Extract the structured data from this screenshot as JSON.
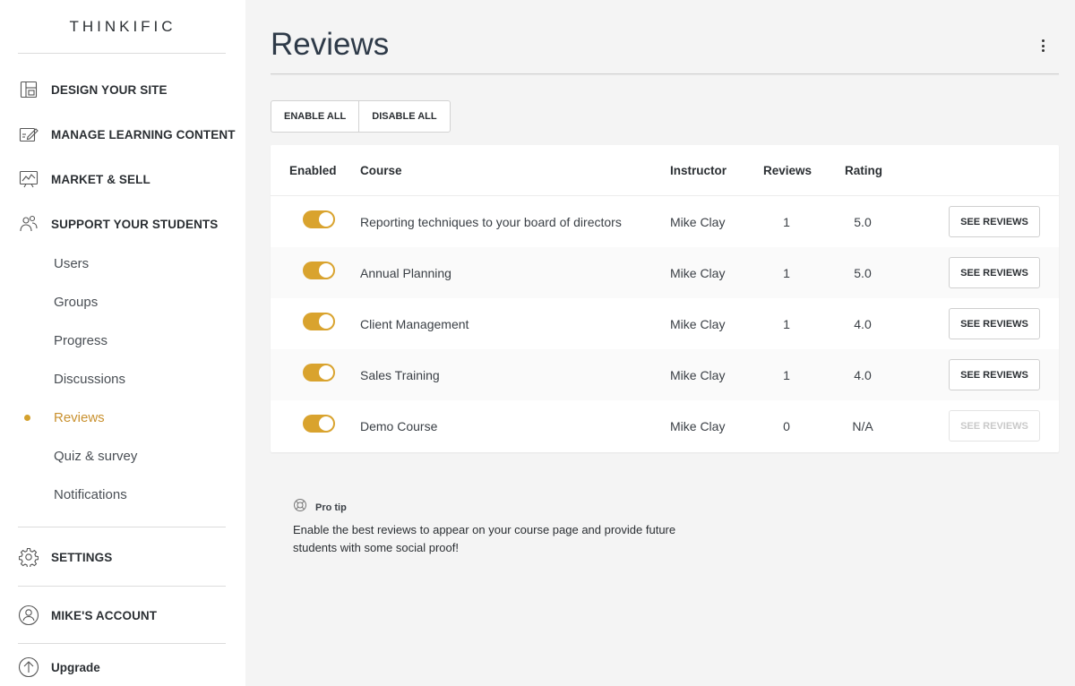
{
  "brand": "THINKIFIC",
  "nav": {
    "design": "DESIGN YOUR SITE",
    "manage": "MANAGE LEARNING CONTENT",
    "market": "MARKET & SELL",
    "support": "SUPPORT YOUR STUDENTS",
    "sub": [
      "Users",
      "Groups",
      "Progress",
      "Discussions",
      "Reviews",
      "Quiz & survey",
      "Notifications"
    ],
    "settings": "SETTINGS",
    "account": "MIKE'S ACCOUNT",
    "upgrade": "Upgrade"
  },
  "page": {
    "title": "Reviews"
  },
  "actions": {
    "enable_all": "ENABLE ALL",
    "disable_all": "DISABLE ALL"
  },
  "table": {
    "headers": {
      "enabled": "Enabled",
      "course": "Course",
      "instructor": "Instructor",
      "reviews": "Reviews",
      "rating": "Rating"
    },
    "see_reviews": "SEE REVIEWS",
    "rows": [
      {
        "course": "Reporting techniques to your board of directors",
        "instructor": "Mike Clay",
        "reviews": "1",
        "rating": "5.0",
        "enabled": true,
        "see_enabled": true
      },
      {
        "course": "Annual Planning",
        "instructor": "Mike Clay",
        "reviews": "1",
        "rating": "5.0",
        "enabled": true,
        "see_enabled": true
      },
      {
        "course": "Client Management",
        "instructor": "Mike Clay",
        "reviews": "1",
        "rating": "4.0",
        "enabled": true,
        "see_enabled": true
      },
      {
        "course": "Sales Training",
        "instructor": "Mike Clay",
        "reviews": "1",
        "rating": "4.0",
        "enabled": true,
        "see_enabled": true
      },
      {
        "course": "Demo Course",
        "instructor": "Mike Clay",
        "reviews": "0",
        "rating": "N/A",
        "enabled": true,
        "see_enabled": false
      }
    ]
  },
  "protip": {
    "label": "Pro tip",
    "text": "Enable the best reviews to appear on your course page and provide future students with some social proof!"
  },
  "colors": {
    "accent": "#d9a32e",
    "active_text": "#c9912f"
  },
  "icons": [
    "layout-icon",
    "edit-icon",
    "chart-icon",
    "users-icon",
    "gear-icon",
    "user-circle-icon",
    "arrow-up-circle-icon",
    "lifebuoy-icon",
    "kebab-menu-icon"
  ]
}
